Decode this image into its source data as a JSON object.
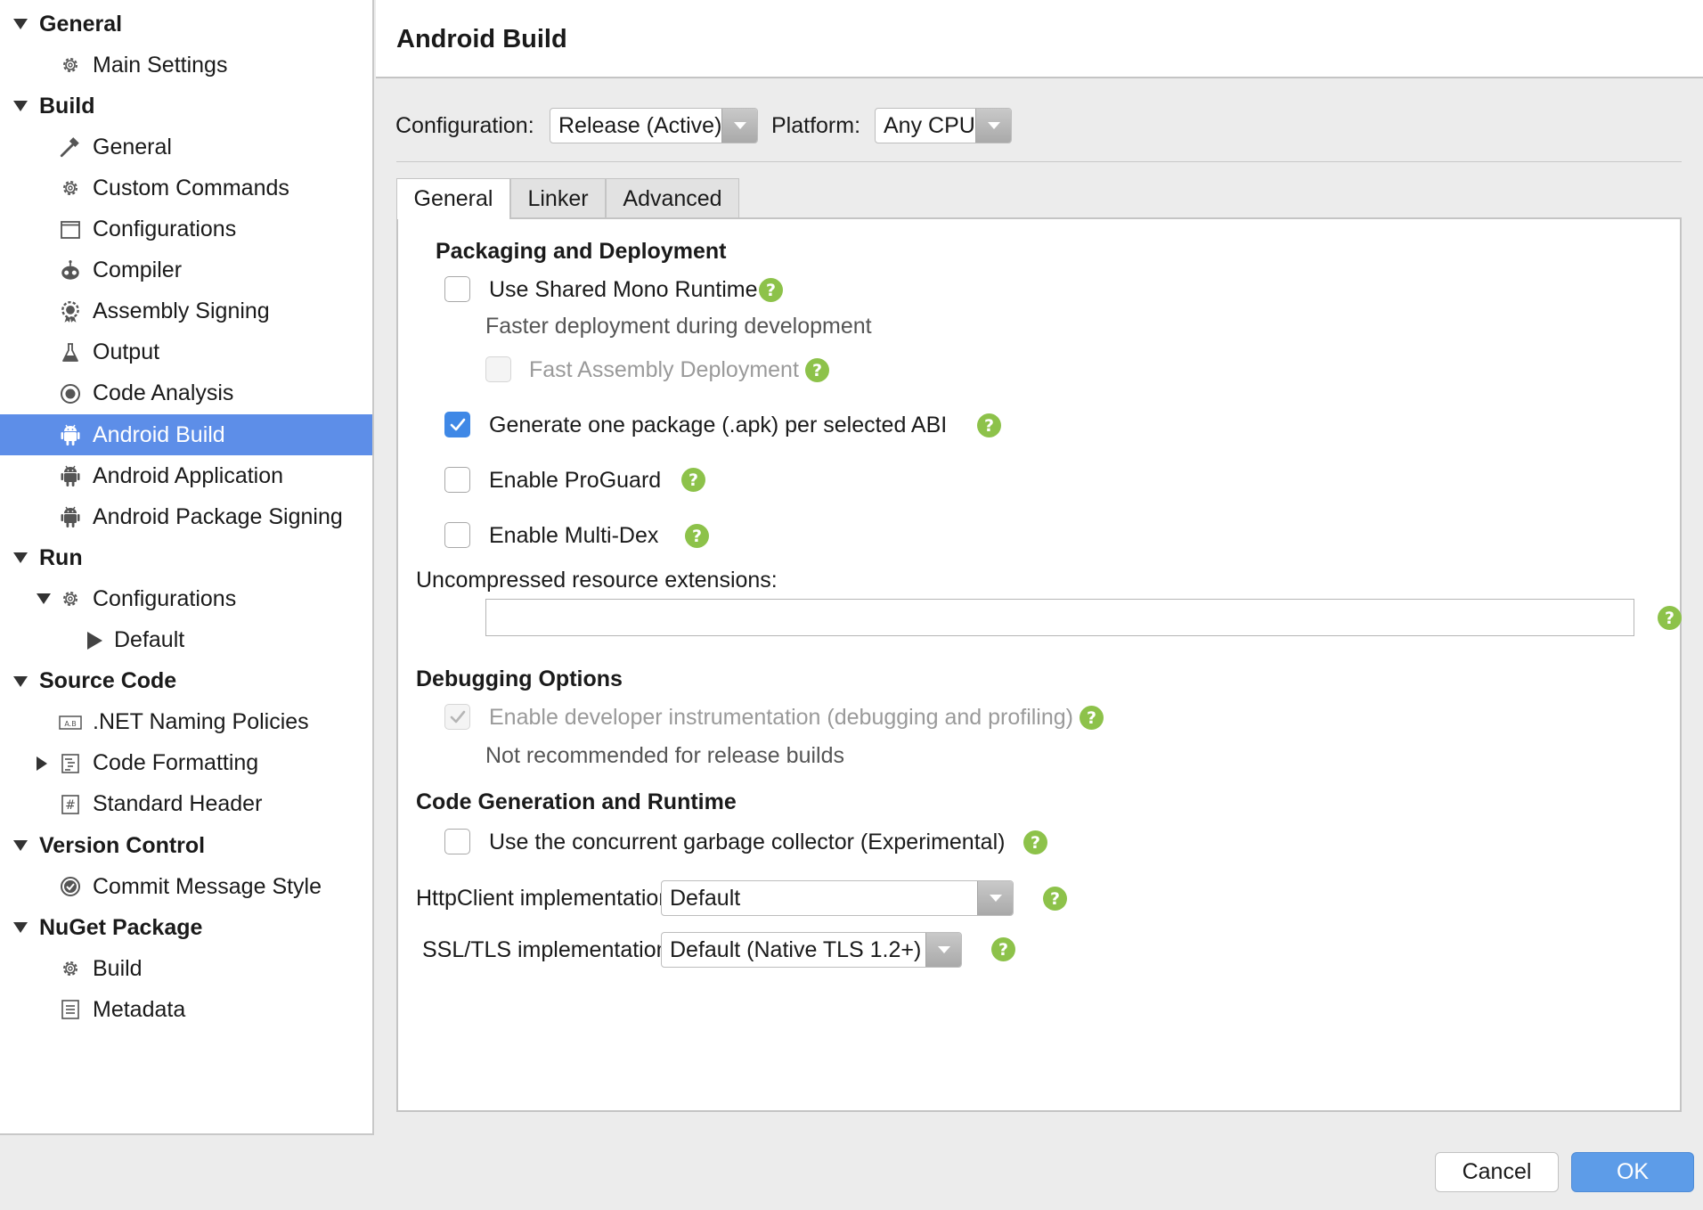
{
  "sidebar": {
    "items": [
      {
        "label": "General",
        "level": 0,
        "section": true,
        "expanded": true
      },
      {
        "label": "Main Settings",
        "level": 1,
        "icon": "gear-icon"
      },
      {
        "label": "Build",
        "level": 0,
        "section": true,
        "expanded": true
      },
      {
        "label": "General",
        "level": 1,
        "icon": "hammer-icon"
      },
      {
        "label": "Custom Commands",
        "level": 1,
        "icon": "gear-icon"
      },
      {
        "label": "Configurations",
        "level": 1,
        "icon": "window-icon"
      },
      {
        "label": "Compiler",
        "level": 1,
        "icon": "robot-icon"
      },
      {
        "label": "Assembly Signing",
        "level": 1,
        "icon": "badge-gear-icon"
      },
      {
        "label": "Output",
        "level": 1,
        "icon": "flask-icon"
      },
      {
        "label": "Code Analysis",
        "level": 1,
        "icon": "target-icon"
      },
      {
        "label": "Android Build",
        "level": 1,
        "icon": "android-icon",
        "selected": true
      },
      {
        "label": "Android Application",
        "level": 1,
        "icon": "android-icon"
      },
      {
        "label": "Android Package Signing",
        "level": 1,
        "icon": "android-icon"
      },
      {
        "label": "Run",
        "level": 0,
        "section": true,
        "expanded": true
      },
      {
        "label": "Configurations",
        "level": 1,
        "icon": "gear-icon",
        "expanded": true
      },
      {
        "label": "Default",
        "level": 2,
        "icon": "play-icon"
      },
      {
        "label": "Source Code",
        "level": 0,
        "section": true,
        "expanded": true
      },
      {
        "label": ".NET Naming Policies",
        "level": 1,
        "icon": "naming-icon"
      },
      {
        "label": "Code Formatting",
        "level": 1,
        "icon": "document-format-icon",
        "expanded": false
      },
      {
        "label": "Standard Header",
        "level": 1,
        "icon": "hash-icon"
      },
      {
        "label": "Version Control",
        "level": 0,
        "section": true,
        "expanded": true
      },
      {
        "label": "Commit Message Style",
        "level": 1,
        "icon": "check-circle-icon"
      },
      {
        "label": "NuGet Package",
        "level": 0,
        "section": true,
        "expanded": true
      },
      {
        "label": "Build",
        "level": 1,
        "icon": "gear-icon"
      },
      {
        "label": "Metadata",
        "level": 1,
        "icon": "list-icon"
      }
    ]
  },
  "main": {
    "title": "Android Build",
    "configuration_label": "Configuration:",
    "configuration_value": "Release (Active)",
    "platform_label": "Platform:",
    "platform_value": "Any CPU",
    "tabs": [
      {
        "label": "General",
        "active": true
      },
      {
        "label": "Linker",
        "active": false
      },
      {
        "label": "Advanced",
        "active": false
      }
    ],
    "packaging": {
      "heading": "Packaging and Deployment",
      "shared_runtime_label": "Use Shared Mono Runtime",
      "shared_runtime_checked": false,
      "shared_runtime_desc": "Faster deployment during development",
      "fast_deploy_label": "Fast Assembly Deployment",
      "fast_deploy_checked": false,
      "per_abi_label": "Generate one package (.apk) per selected ABI",
      "per_abi_checked": true,
      "proguard_label": "Enable ProGuard",
      "proguard_checked": false,
      "multidex_label": "Enable Multi-Dex",
      "multidex_checked": false,
      "uncompressed_label": "Uncompressed resource extensions:",
      "uncompressed_value": ""
    },
    "debugging": {
      "heading": "Debugging Options",
      "instrumentation_label": "Enable developer instrumentation (debugging and profiling)",
      "instrumentation_checked": true,
      "instrumentation_desc": "Not recommended for release builds"
    },
    "codegen": {
      "heading": "Code Generation and Runtime",
      "concurrent_gc_label": "Use the concurrent garbage collector (Experimental)",
      "concurrent_gc_checked": false,
      "httpclient_label": "HttpClient implementation",
      "httpclient_value": "Default",
      "ssl_label": "SSL/TLS implementation",
      "ssl_value": "Default (Native TLS 1.2+)"
    },
    "help_glyph": "?"
  },
  "footer": {
    "cancel_label": "Cancel",
    "ok_label": "OK"
  },
  "colors": {
    "selection": "#5d8ee8",
    "help": "#8dc24a",
    "checkbox_checked": "#3f88e6",
    "ok_button": "#5d9ce8"
  }
}
